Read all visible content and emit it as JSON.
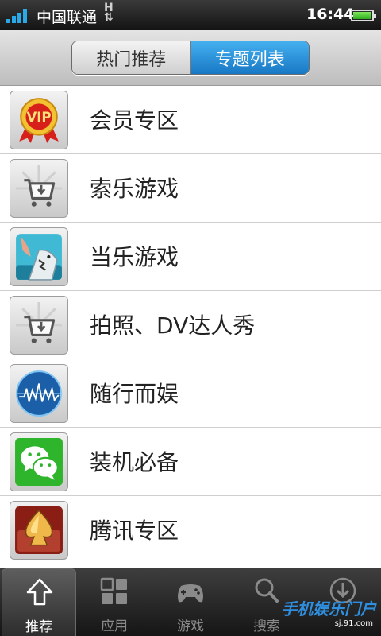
{
  "status_bar": {
    "carrier": "中国联通",
    "network": "H",
    "time": "16:44"
  },
  "segmented_tabs": [
    {
      "label": "热门推荐",
      "active": false
    },
    {
      "label": "专题列表",
      "active": true
    }
  ],
  "topics": [
    {
      "label": "会员专区",
      "icon": "vip-badge-icon"
    },
    {
      "label": "索乐游戏",
      "icon": "shopping-cart-icon"
    },
    {
      "label": "当乐游戏",
      "icon": "shark-game-icon"
    },
    {
      "label": "拍照、DV达人秀",
      "icon": "shopping-cart-icon"
    },
    {
      "label": "随行而娱",
      "icon": "soundwave-globe-icon"
    },
    {
      "label": "装机必备",
      "icon": "wechat-icon"
    },
    {
      "label": "腾讯专区",
      "icon": "spade-card-icon"
    }
  ],
  "bottom_nav": [
    {
      "label": "推荐",
      "icon": "home-arrow-icon",
      "active": true
    },
    {
      "label": "应用",
      "icon": "apps-grid-icon",
      "active": false
    },
    {
      "label": "游戏",
      "icon": "gamepad-icon",
      "active": false
    },
    {
      "label": "搜索",
      "icon": "search-icon",
      "active": false
    },
    {
      "label": "",
      "icon": "download-icon",
      "active": false
    }
  ],
  "watermark": {
    "brand": "手机娱乐门户",
    "url": "sj.91.com"
  },
  "colors": {
    "accent_blue": "#1f8fdc",
    "battery_green": "#3cc12a"
  }
}
